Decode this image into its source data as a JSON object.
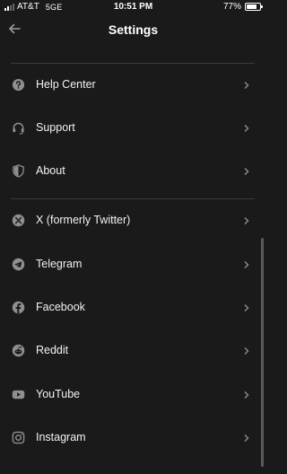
{
  "status_bar": {
    "carrier": "AT&T",
    "network": "5GE",
    "time": "10:51 PM",
    "battery": "77%",
    "battery_level": 0.77
  },
  "header": {
    "title": "Settings",
    "back_icon": "arrow-left-icon"
  },
  "sections": {
    "support": [
      {
        "label": "Help Center",
        "icon": "question-circle-icon"
      },
      {
        "label": "Support",
        "icon": "headset-icon"
      },
      {
        "label": "About",
        "icon": "shield-icon"
      }
    ],
    "social": [
      {
        "label": "X (formerly Twitter)",
        "icon": "x-twitter-icon"
      },
      {
        "label": "Telegram",
        "icon": "telegram-icon"
      },
      {
        "label": "Facebook",
        "icon": "facebook-icon"
      },
      {
        "label": "Reddit",
        "icon": "reddit-icon"
      },
      {
        "label": "YouTube",
        "icon": "youtube-icon"
      },
      {
        "label": "Instagram",
        "icon": "instagram-icon"
      }
    ]
  },
  "colors": {
    "background": "#1a1a1a",
    "icon": "#8e8e93",
    "chevron": "#8e8e93",
    "divider": "#3a3a3a"
  }
}
